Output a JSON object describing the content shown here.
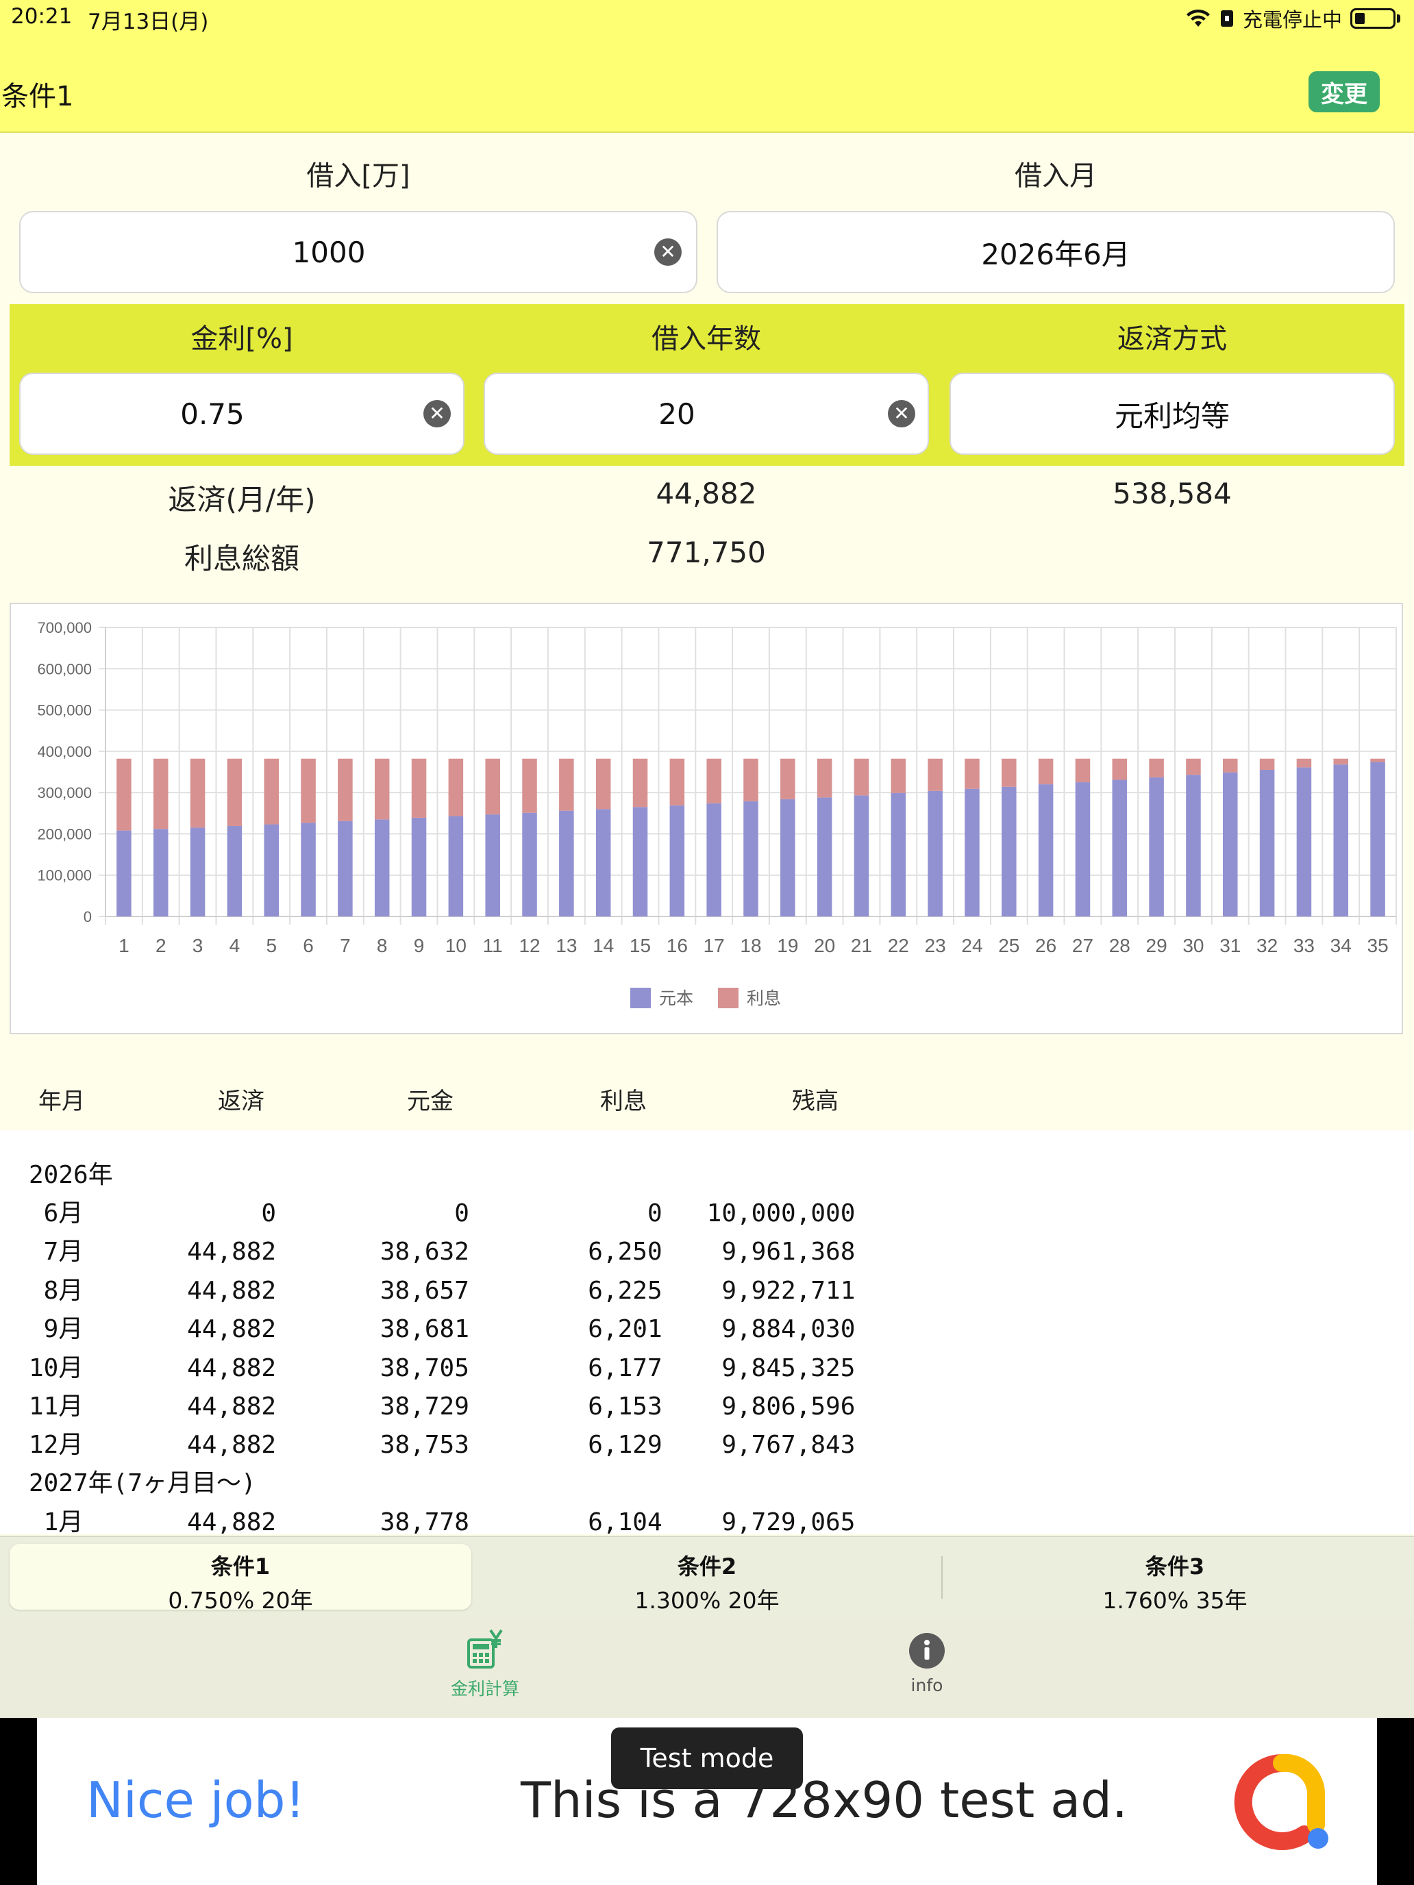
{
  "status_bar": {
    "time": "20:21",
    "date": "7月13日(月)",
    "charging": "充電停止中"
  },
  "header": {
    "title": "条件1",
    "change_label": "変更"
  },
  "form": {
    "loan_label": "借入[万]",
    "loan_value": "1000",
    "month_label": "借入月",
    "month_value": "2026年6月",
    "rate_label": "金利[%]",
    "rate_value": "0.75",
    "years_label": "借入年数",
    "years_value": "20",
    "method_label": "返済方式",
    "method_value": "元利均等"
  },
  "results": {
    "repay_label": "返済(月/年)",
    "monthly": "44,882",
    "yearly": "538,584",
    "interest_label": "利息総額",
    "interest_total": "771,750"
  },
  "chart_data": {
    "type": "bar",
    "stacked": true,
    "categories": [
      "1",
      "2",
      "3",
      "4",
      "5",
      "6",
      "7",
      "8",
      "9",
      "10",
      "11",
      "12",
      "13",
      "14",
      "15",
      "16",
      "17",
      "18",
      "19",
      "20",
      "21",
      "22",
      "23",
      "24",
      "25",
      "26",
      "27",
      "28",
      "29",
      "30",
      "31",
      "32",
      "33",
      "34",
      "35"
    ],
    "series": [
      {
        "name": "元本",
        "color": "#9191d2",
        "values": [
          208000,
          212000,
          215000,
          219000,
          223000,
          227000,
          231000,
          235000,
          239000,
          243000,
          247000,
          251000,
          256000,
          260000,
          265000,
          269000,
          274000,
          279000,
          284000,
          288000,
          293000,
          299000,
          304000,
          309000,
          314000,
          320000,
          325000,
          331000,
          337000,
          343000,
          349000,
          355000,
          361000,
          368000,
          374000
        ]
      },
      {
        "name": "利息",
        "color": "#d79191",
        "values": [
          174000,
          170000,
          167000,
          163000,
          159000,
          155000,
          151000,
          147000,
          143000,
          139000,
          135000,
          131000,
          126000,
          122000,
          117000,
          113000,
          108000,
          103000,
          98000,
          94000,
          89000,
          83000,
          78000,
          73000,
          68000,
          62000,
          57000,
          51000,
          45000,
          39000,
          33000,
          27000,
          21000,
          14000,
          8000
        ]
      }
    ],
    "yticks": [
      "0",
      "100,000",
      "200,000",
      "300,000",
      "400,000",
      "500,000",
      "600,000",
      "700,000"
    ],
    "ylim": [
      0,
      700000
    ],
    "grid": true,
    "legend_position": "bottom"
  },
  "table": {
    "headers": [
      "年月",
      "返済",
      "元金",
      "利息",
      "残高"
    ],
    "lines": [
      "2026年",
      " 6月            0            0            0   10,000,000",
      " 7月       44,882       38,632        6,250    9,961,368",
      " 8月       44,882       38,657        6,225    9,922,711",
      " 9月       44,882       38,681        6,201    9,884,030",
      "10月       44,882       38,705        6,177    9,845,325",
      "11月       44,882       38,729        6,153    9,806,596",
      "12月       44,882       38,753        6,129    9,767,843",
      "2027年(7ヶ月目～)",
      " 1月       44,882       38,778        6,104    9,729,065"
    ]
  },
  "segments": [
    {
      "title": "条件1",
      "sub": "0.750% 20年"
    },
    {
      "title": "条件2",
      "sub": "1.300% 20年"
    },
    {
      "title": "条件3",
      "sub": "1.760% 35年"
    }
  ],
  "tabs": {
    "calc_label": "金利計算",
    "info_label": "info",
    "accent": "#3aa96b"
  },
  "ad": {
    "nice": "Nice job!",
    "text": "This is a 728x90 test ad.",
    "badge": "Test mode"
  }
}
